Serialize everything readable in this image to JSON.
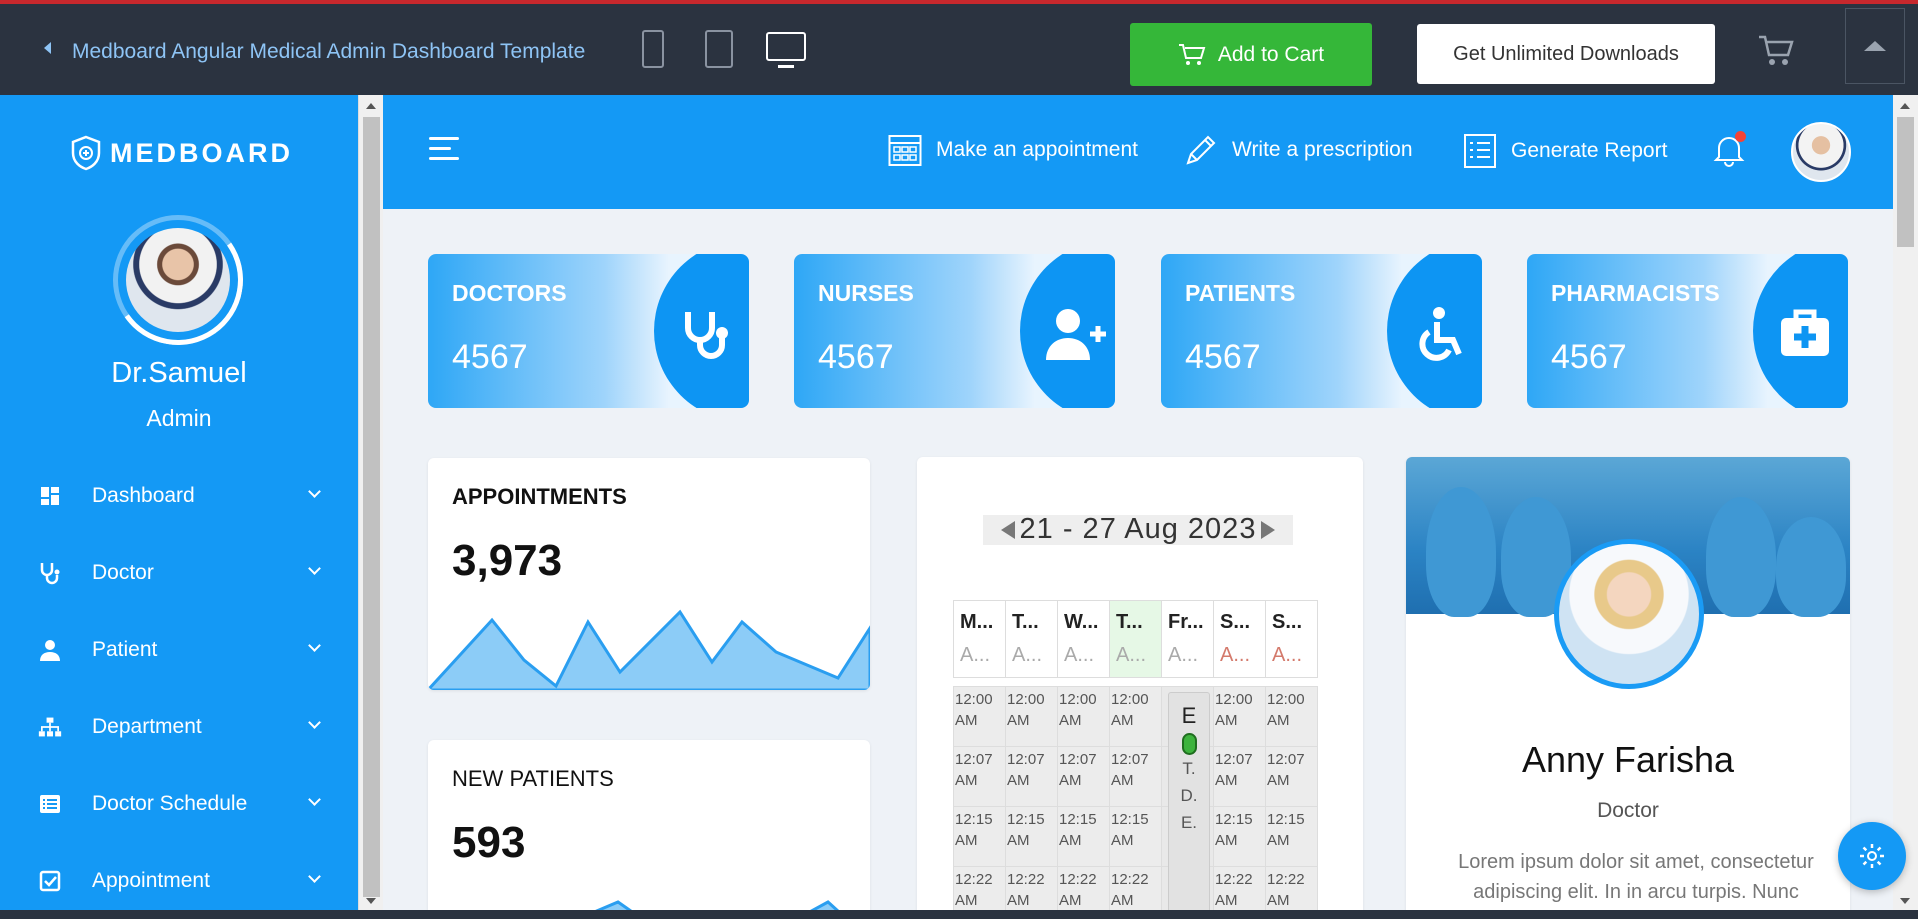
{
  "topbar": {
    "title": "Medboard Angular Medical Admin Dashboard Template",
    "add_to_cart": "Add to Cart",
    "unlimited": "Get Unlimited Downloads"
  },
  "sidebar": {
    "logo": "MEDBOARD",
    "user_name": "Dr.Samuel",
    "user_role": "Admin",
    "items": [
      {
        "label": "Dashboard",
        "icon": "dashboard-icon"
      },
      {
        "label": "Doctor",
        "icon": "stethoscope-icon"
      },
      {
        "label": "Patient",
        "icon": "person-icon"
      },
      {
        "label": "Department",
        "icon": "sitemap-icon"
      },
      {
        "label": "Doctor Schedule",
        "icon": "list-icon"
      },
      {
        "label": "Appointment",
        "icon": "checkbox-icon"
      }
    ]
  },
  "header": {
    "actions": [
      {
        "label": "Make an appointment",
        "icon": "calendar-grid-icon"
      },
      {
        "label": "Write a prescription",
        "icon": "pencil-icon"
      },
      {
        "label": "Generate Report",
        "icon": "report-list-icon"
      }
    ]
  },
  "stats": [
    {
      "title": "DOCTORS",
      "value": "4567",
      "icon": "stethoscope-icon"
    },
    {
      "title": "NURSES",
      "value": "4567",
      "icon": "user-plus-icon"
    },
    {
      "title": "PATIENTS",
      "value": "4567",
      "icon": "wheelchair-icon"
    },
    {
      "title": "PHARMACISTS",
      "value": "4567",
      "icon": "medkit-icon"
    }
  ],
  "appointments": {
    "title": "APPOINTMENTS",
    "value": "3,973"
  },
  "new_patients": {
    "title": "NEW PATIENTS",
    "value": "593"
  },
  "calendar": {
    "range": "21 - 27 Aug 2023",
    "days": [
      {
        "name": "M...",
        "sub": "A..."
      },
      {
        "name": "T...",
        "sub": "A..."
      },
      {
        "name": "W...",
        "sub": "A..."
      },
      {
        "name": "T...",
        "sub": "A..."
      },
      {
        "name": "Fr...",
        "sub": "A..."
      },
      {
        "name": "S...",
        "sub": "A..."
      },
      {
        "name": "S...",
        "sub": "A..."
      }
    ],
    "times": [
      "12:00 AM",
      "12:07 AM",
      "12:15 AM",
      "12:22 AM"
    ],
    "event": {
      "line1": "E",
      "line2": "T.",
      "line3": "D.",
      "line4": "E."
    }
  },
  "profile": {
    "name": "Anny Farisha",
    "role": "Doctor",
    "desc": "Lorem ipsum dolor sit amet, consectetur adipiscing elit. In in arcu turpis. Nunc"
  },
  "colors": {
    "primary": "#1499f5",
    "cart_green": "#35b739",
    "topbar": "#2b3340"
  }
}
